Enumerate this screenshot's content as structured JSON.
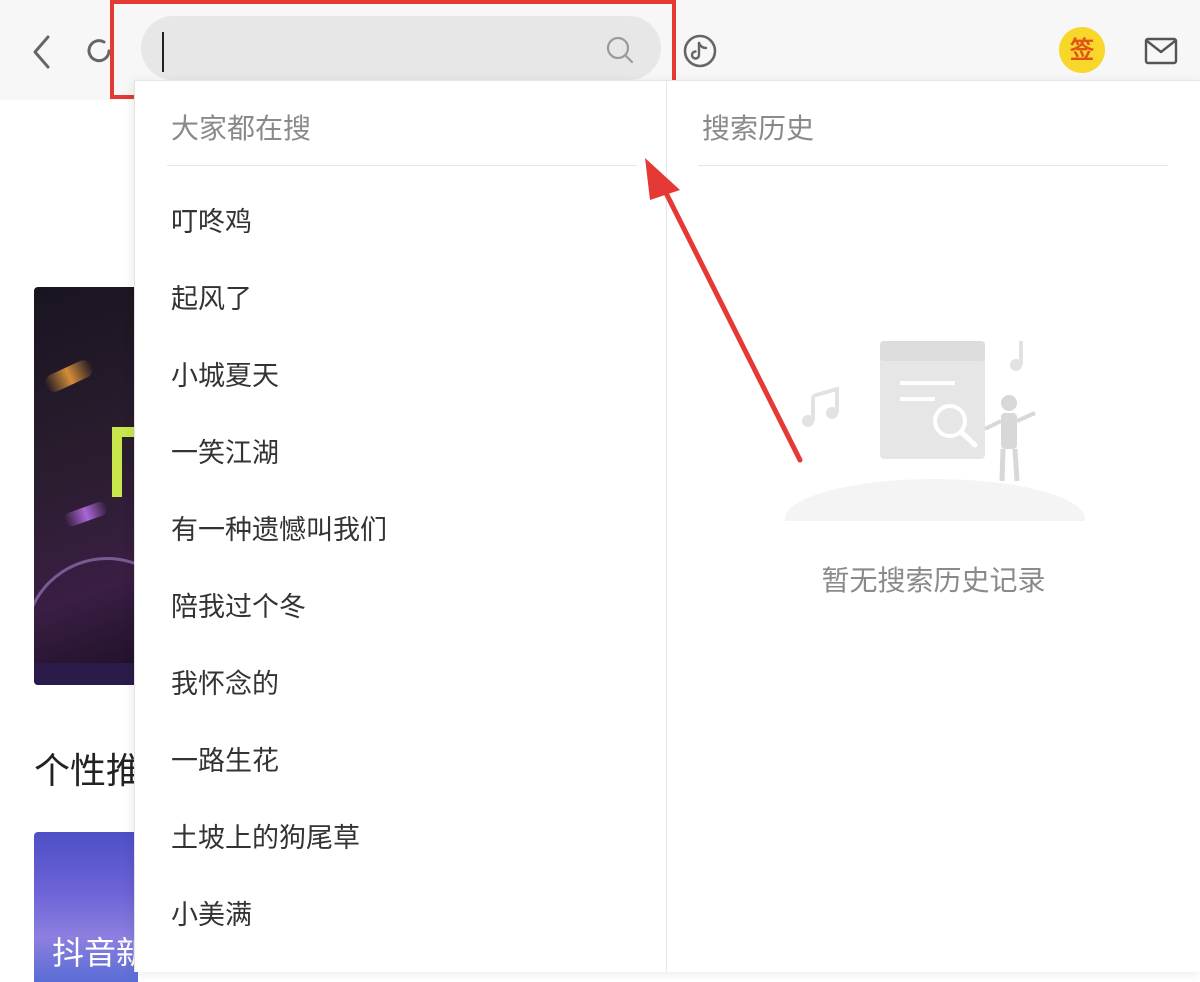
{
  "toolbar": {
    "back_icon": "chevron-left-icon",
    "refresh_icon": "refresh-icon",
    "search": {
      "value": "",
      "placeholder": "",
      "icon": "search-icon"
    },
    "tiktok_icon": "tiktok-icon",
    "sign_badge": "签",
    "mail_icon": "mail-icon"
  },
  "background": {
    "section_heading": "个性推",
    "bottom_card_text": "抖音新"
  },
  "dropdown": {
    "hot_title": "大家都在搜",
    "hot_items": [
      "叮咚鸡",
      "起风了",
      "小城夏天",
      "一笑江湖",
      "有一种遗憾叫我们",
      "陪我过个冬",
      "我怀念的",
      "一路生花",
      "土坡上的狗尾草",
      "小美满"
    ],
    "history_title": "搜索历史",
    "history_empty_text": "暂无搜索历史记录"
  },
  "colors": {
    "annotation_red": "#e53935",
    "sign_badge_bg": "#f8d72a",
    "sign_badge_text": "#e0531a"
  }
}
